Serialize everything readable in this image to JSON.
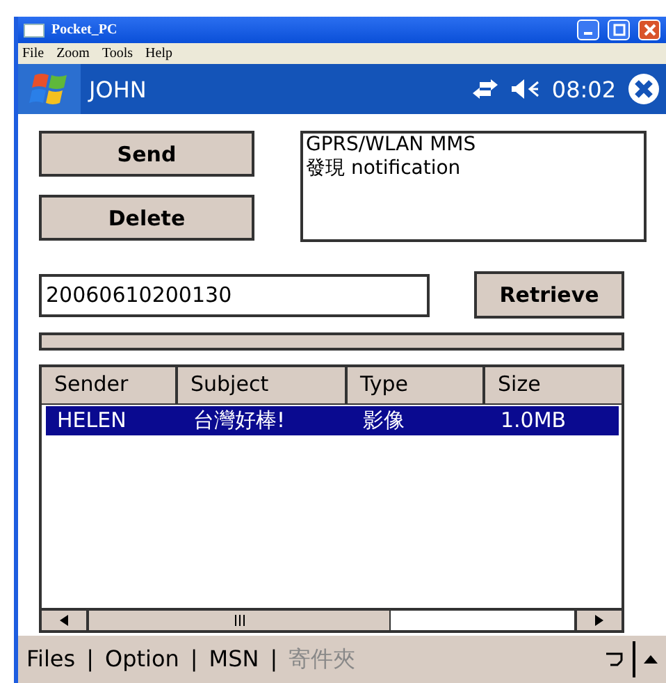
{
  "window": {
    "title": "Pocket_PC"
  },
  "menu": [
    "File",
    "Zoom",
    "Tools",
    "Help"
  ],
  "nav_bar": {
    "title": "JOHN",
    "time": "08:02"
  },
  "buttons": [
    {
      "label": "Send"
    },
    {
      "label": "Delete"
    }
  ],
  "message_box": {
    "lines": [
      "GPRS/WLAN MMS",
      "發現 notification"
    ]
  },
  "id_field": {
    "value": "20060610200130"
  },
  "retrieve_button": {
    "label": "Retrieve"
  },
  "progress": {
    "level": 0
  },
  "table": {
    "columns": [
      "Sender",
      "Subject",
      "Type",
      "Size"
    ],
    "rows": [
      {
        "cells": [
          "HELEN",
          "台灣好棒!",
          "影像",
          "1.0MB"
        ],
        "selected": true
      }
    ]
  },
  "bottom_menu": [
    {
      "kind": "item",
      "label": "Files",
      "disabled": false
    },
    {
      "kind": "separator",
      "label": "|"
    },
    {
      "kind": "item",
      "label": "Option",
      "disabled": false
    },
    {
      "kind": "separator",
      "label": "|"
    },
    {
      "kind": "item",
      "label": "MSN",
      "disabled": false
    },
    {
      "kind": "separator",
      "label": "|"
    },
    {
      "kind": "item",
      "label": "寄件夾",
      "disabled": true
    }
  ]
}
